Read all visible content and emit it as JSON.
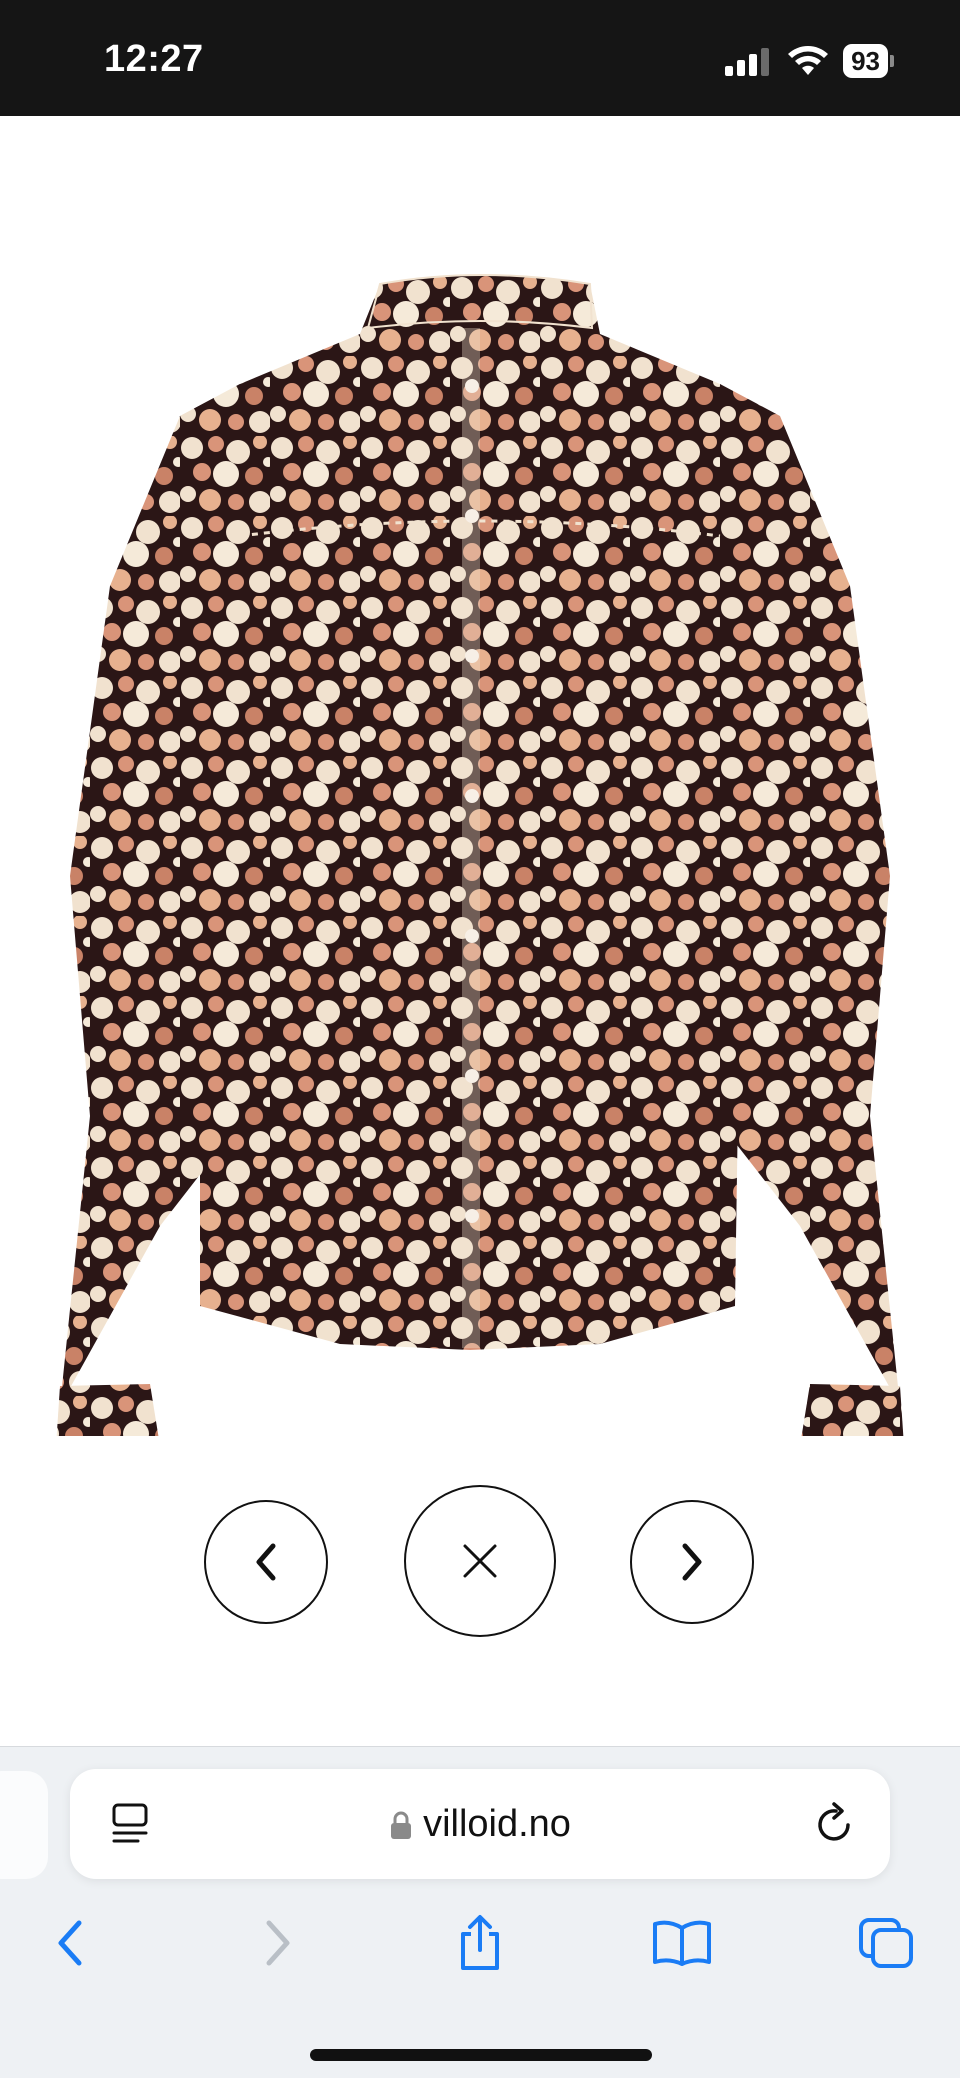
{
  "status_bar": {
    "time": "12:27",
    "battery": "93",
    "icons": [
      "cellular-signal-icon",
      "wifi-icon",
      "battery-icon"
    ]
  },
  "product": {
    "image_description_icon": "floral-print-blouse-image"
  },
  "gallery_controls": {
    "previous_icon": "chevron-left-icon",
    "close_icon": "close-icon",
    "next_icon": "chevron-right-icon"
  },
  "browser": {
    "url": "villoid.no",
    "reader_icon": "page-menu-icon",
    "lock_icon": "lock-icon",
    "reload_icon": "reload-icon",
    "toolbar": [
      "back-icon",
      "forward-icon",
      "share-icon",
      "bookmarks-icon",
      "tabs-icon"
    ]
  },
  "colors": {
    "status_bar_bg": "#151515",
    "safari_accent": "#1a7cf5",
    "toolbar_bg": "#eef1f4",
    "print_dark": "#2b1616",
    "print_peach": "#d99479",
    "print_cream": "#f1e2cf"
  }
}
